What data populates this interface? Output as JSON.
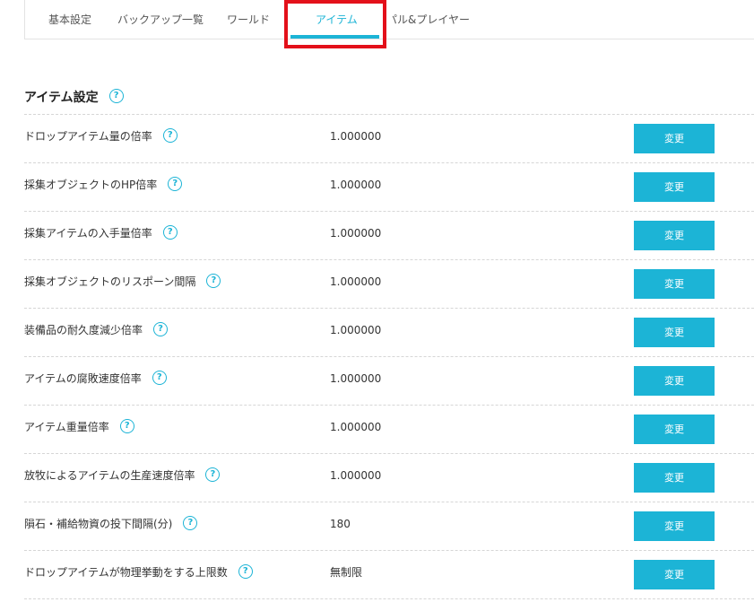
{
  "tabs": [
    {
      "label": "基本設定"
    },
    {
      "label": "バックアップ一覧"
    },
    {
      "label": "ワールド"
    },
    {
      "label": "アイテム"
    },
    {
      "label": "パル&プレイヤー"
    }
  ],
  "active_tab": "アイテム",
  "section": {
    "title": "アイテム設定",
    "help": "?"
  },
  "rows": [
    {
      "label": "ドロップアイテム量の倍率",
      "value": "1.000000",
      "button": "変更"
    },
    {
      "label": "採集オブジェクトのHP倍率",
      "value": "1.000000",
      "button": "変更"
    },
    {
      "label": "採集アイテムの入手量倍率",
      "value": "1.000000",
      "button": "変更"
    },
    {
      "label": "採集オブジェクトのリスポーン間隔",
      "value": "1.000000",
      "button": "変更"
    },
    {
      "label": "装備品の耐久度減少倍率",
      "value": "1.000000",
      "button": "変更"
    },
    {
      "label": "アイテムの腐敗速度倍率",
      "value": "1.000000",
      "button": "変更"
    },
    {
      "label": "アイテム重量倍率",
      "value": "1.000000",
      "button": "変更"
    },
    {
      "label": "放牧によるアイテムの生産速度倍率",
      "value": "1.000000",
      "button": "変更"
    },
    {
      "label": "隕石・補給物資の投下間隔(分)",
      "value": "180",
      "button": "変更"
    },
    {
      "label": "ドロップアイテムが物理挙動をする上限数",
      "value": "無制限",
      "button": "変更"
    }
  ],
  "colors": {
    "accent": "#1cb4d6",
    "highlight": "#e3101a"
  }
}
